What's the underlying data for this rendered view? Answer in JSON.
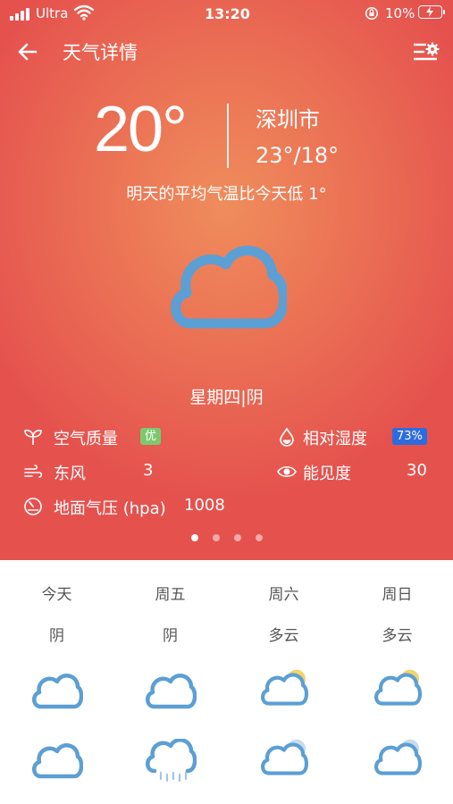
{
  "status_bar": {
    "carrier": "Ultra",
    "time": "13:20",
    "battery_pct": "10%"
  },
  "header": {
    "title": "天气详情"
  },
  "current": {
    "temperature": "20°",
    "city": "深圳市",
    "range": "23°/18°",
    "comparison": "明天的平均气温比今天低 1°",
    "weekday_condition": "星期四|阴",
    "icon": "cloud-icon"
  },
  "metrics": {
    "air_quality_label": "空气质量",
    "air_quality_value": "优",
    "humidity_label": "相对湿度",
    "humidity_value": "73%",
    "wind_label": "东风",
    "wind_value": "3",
    "visibility_label": "能见度",
    "visibility_value": "30",
    "pressure_label": "地面气压 (hpa)",
    "pressure_value": "1008"
  },
  "pager": {
    "pages": 4,
    "active": 0
  },
  "colors": {
    "hero_center": "#ef8d5c",
    "hero_edge": "#e5524e",
    "icon_blue": "#5b9fd4",
    "sun_yellow": "#f3d36a",
    "good_badge": "#7bc96f",
    "humidity_badge": "#2d6cdf"
  },
  "forecast": [
    {
      "day": "今天",
      "condition": "阴",
      "day_icon": "cloud-icon",
      "night_icon": "cloud-icon"
    },
    {
      "day": "周五",
      "condition": "阴",
      "day_icon": "cloud-icon",
      "night_icon": "cloud-rain-icon"
    },
    {
      "day": "周六",
      "condition": "多云",
      "day_icon": "cloud-sun-icon",
      "night_icon": "cloud-moon-icon"
    },
    {
      "day": "周日",
      "condition": "多云",
      "day_icon": "cloud-sun-icon",
      "night_icon": "cloud-moon-icon"
    }
  ]
}
